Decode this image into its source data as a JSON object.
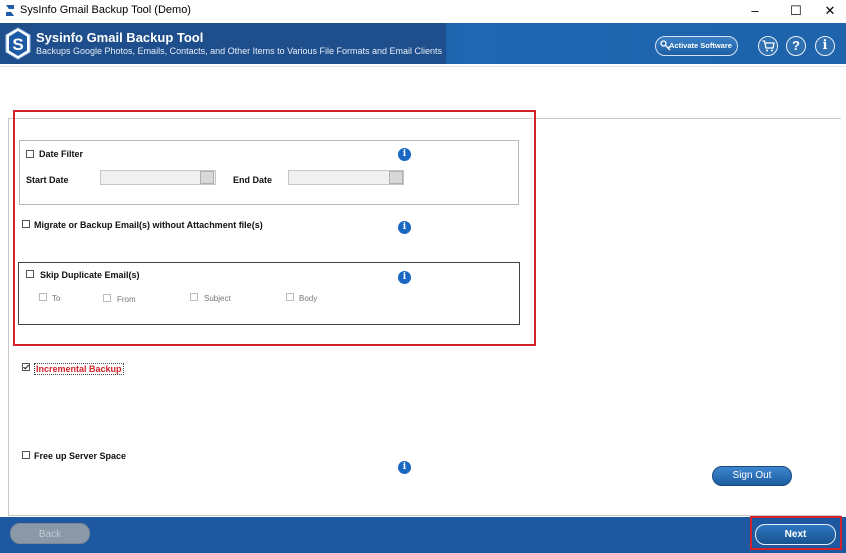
{
  "window": {
    "title": "SysInfo Gmail Backup Tool (Demo)",
    "minimize": "–",
    "maximize": "☐",
    "close": "✕"
  },
  "header": {
    "title": "Sysinfo Gmail Backup Tool",
    "subtitle": "Backups Google Photos, Emails, Contacts, and Other Items to Various File Formats and Email Clients",
    "activate_label": "Activate Software",
    "cart_icon": "cart-icon",
    "help_glyph": "?",
    "info_glyph": "i"
  },
  "filters": {
    "date_filter_label": "Date Filter",
    "start_date_label": "Start Date",
    "end_date_label": "End Date",
    "start_date_value": "",
    "end_date_value": "",
    "without_attachments_label": "Migrate or Backup Email(s) without Attachment file(s)",
    "skip_duplicate_label": "Skip Duplicate Email(s)",
    "dup_options": [
      "To",
      "From",
      "Subject",
      "Body"
    ],
    "incremental_label": "Incremental Backup",
    "incremental_checked": true,
    "free_space_label": "Free up Server Space",
    "info_glyph": "i"
  },
  "buttons": {
    "sign_out": "Sign Out",
    "back": "Back",
    "next": "Next"
  },
  "colors": {
    "header_blue": "#1e4f8c",
    "footer_blue": "#1e58a0",
    "highlight_red": "#d2232a",
    "info_blue": "#1a67c4"
  }
}
